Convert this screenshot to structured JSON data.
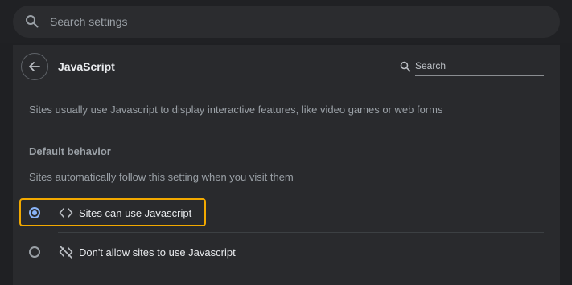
{
  "top_search": {
    "placeholder": "Search settings",
    "icon": "search-icon"
  },
  "page": {
    "title": "JavaScript",
    "back_icon": "arrow-left-icon",
    "search_placeholder": "Search",
    "description": "Sites usually use Javascript to display interactive features, like video games or web forms"
  },
  "default_behavior": {
    "heading": "Default behavior",
    "subtext": "Sites automatically follow this setting when you visit them",
    "options": [
      {
        "label": "Sites can use Javascript",
        "icon": "code-brackets-icon",
        "selected": true
      },
      {
        "label": "Don't allow sites to use Javascript",
        "icon": "code-off-icon",
        "selected": false
      }
    ]
  },
  "colors": {
    "accent": "#8ab4f8",
    "highlight": "#f2a900",
    "background": "#292a2d"
  }
}
